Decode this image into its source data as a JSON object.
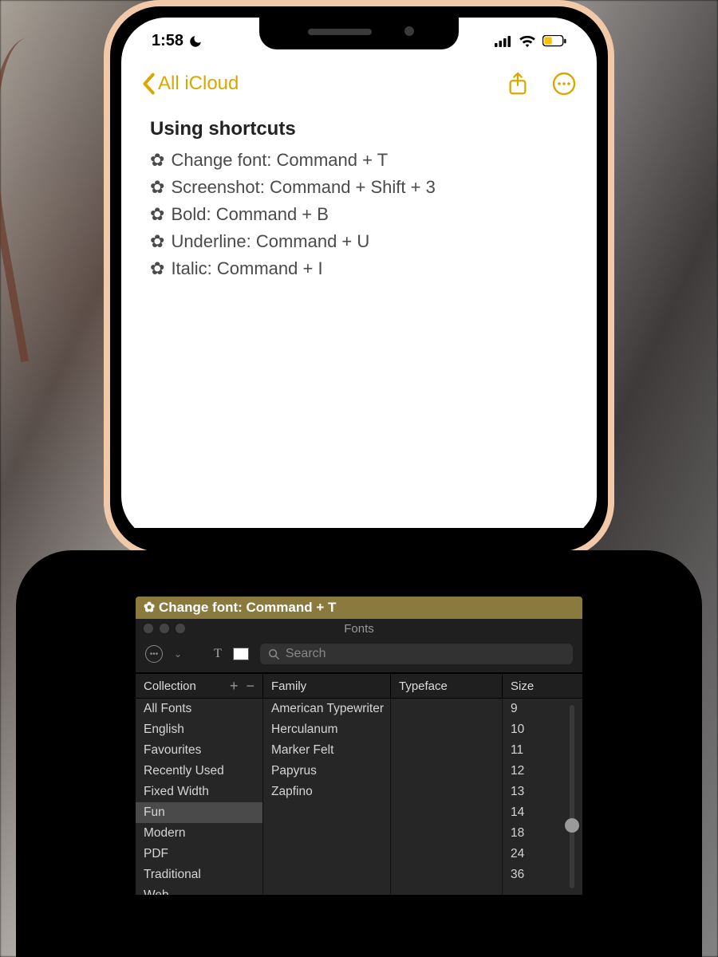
{
  "status": {
    "time": "1:58",
    "dnd": true,
    "battery_low": true
  },
  "nav": {
    "back_label": "All iCloud"
  },
  "note": {
    "title": "Using shortcuts",
    "lines": [
      "Change font: Command + T",
      "Screenshot: Command + Shift + 3",
      "Bold: Command + B",
      "Underline: Command + U",
      "Italic: Command + I"
    ],
    "bullet": "✿"
  },
  "fonts_panel": {
    "hint": "✿ Change font: Command + T",
    "title": "Fonts",
    "search_placeholder": "Search",
    "headers": {
      "collection": "Collection",
      "family": "Family",
      "typeface": "Typeface",
      "size": "Size"
    },
    "collections": [
      "All Fonts",
      "English",
      "Favourites",
      "Recently Used",
      "Fixed Width",
      "Fun",
      "Modern",
      "PDF",
      "Traditional",
      "Web"
    ],
    "collection_selected": "Fun",
    "families": [
      "American Typewriter",
      "Herculanum",
      "Marker Felt",
      "Papyrus",
      "Zapfino"
    ],
    "sizes": [
      "9",
      "10",
      "11",
      "12",
      "13",
      "14",
      "18",
      "24",
      "36"
    ]
  },
  "colors": {
    "accent": "#d9a800",
    "hint_bar": "#8b7a3e"
  }
}
